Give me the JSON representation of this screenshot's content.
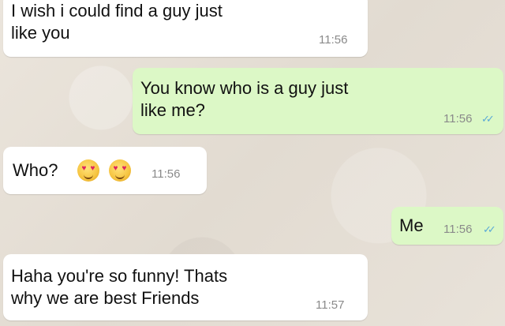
{
  "messages": [
    {
      "text": "I wish i could find a guy just\nlike you",
      "time": "11:56"
    },
    {
      "text": "You know who is a guy just\nlike me?",
      "time": "11:56",
      "ticks": "✓✓"
    },
    {
      "text": "Who?",
      "time": "11:56",
      "emojis": [
        "smiling-face-with-heart-eyes",
        "smiling-face-with-heart-eyes"
      ]
    },
    {
      "text": "Me",
      "time": "11:56",
      "ticks": "✓✓"
    },
    {
      "text": "Haha you're so funny! Thats\nwhy we are best Friends",
      "time": "11:57"
    }
  ],
  "colors": {
    "incoming_bubble": "#ffffff",
    "outgoing_bubble": "#dcf8c6",
    "read_ticks": "#5aa9d6"
  }
}
